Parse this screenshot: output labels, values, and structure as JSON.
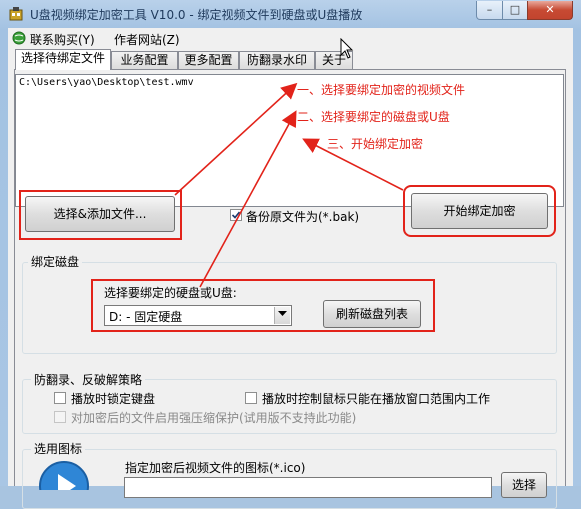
{
  "window": {
    "title": "U盘视频绑定加密工具 V10.0 - 绑定视频文件到硬盘或U盘播放",
    "min_glyph": "–",
    "max_glyph": "□",
    "close_glyph": "✕"
  },
  "menu": {
    "items": [
      "联系购买(Y)",
      "作者网站(Z)"
    ]
  },
  "tabs": [
    "选择待绑定文件",
    "业务配置",
    "更多配置",
    "防翻录水印",
    "关于"
  ],
  "file_list": {
    "items": [
      "C:\\Users\\yao\\Desktop\\test.wmv"
    ]
  },
  "annotations": {
    "step1": "一、选择要绑定加密的视频文件",
    "step2": "二、选择要绑定的磁盘或U盘",
    "step3": "三、开始绑定加密",
    "color": "#e2231a"
  },
  "actions": {
    "select_file": "选择&添加文件...",
    "backup_label": "备份原文件为(*.bak)",
    "backup_checked": true,
    "start": "开始绑定加密"
  },
  "bind_disk": {
    "group_label": "绑定磁盘",
    "prompt": "选择要绑定的硬盘或U盘:",
    "selected_disk": "D: - 固定硬盘",
    "refresh": "刷新磁盘列表"
  },
  "anti_record": {
    "group_label": "防翻录、反破解策略",
    "lock_keyboard": "播放时锁定键盘",
    "limit_mouse": "播放时控制鼠标只能在播放窗口范围内工作",
    "compress_protect": "对加密后的文件启用强压缩保护(试用版不支持此功能)"
  },
  "icon_section": {
    "group_label": "选用图标",
    "icon_label": "指定加密后视频文件的图标(*.ico)",
    "choose": "选择"
  }
}
